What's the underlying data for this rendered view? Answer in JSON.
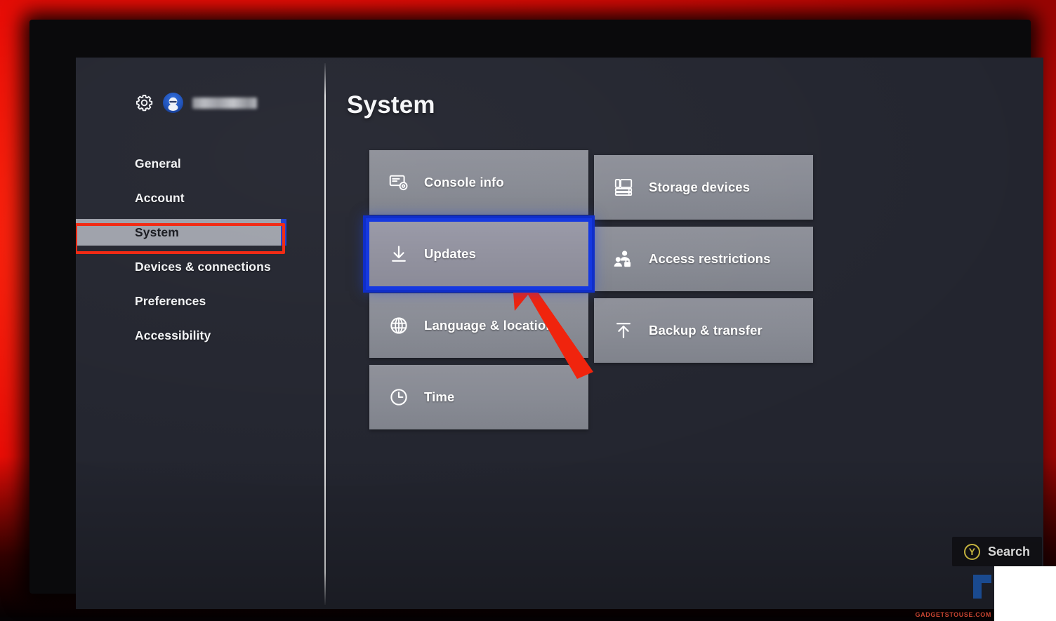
{
  "device": {
    "frame_color": "#e80d06",
    "screen_bg": "#23252f"
  },
  "sidebar": {
    "gear_icon": "gear-icon",
    "avatar_icon": "avatar-icon",
    "gamertag": "",
    "items": [
      {
        "label": "General",
        "selected": false
      },
      {
        "label": "Account",
        "selected": false
      },
      {
        "label": "System",
        "selected": true
      },
      {
        "label": "Devices & connections",
        "selected": false
      },
      {
        "label": "Preferences",
        "selected": false
      },
      {
        "label": "Accessibility",
        "selected": false
      }
    ]
  },
  "main": {
    "title": "System",
    "tiles_left": [
      {
        "label": "Console info",
        "icon": "console-info-icon",
        "focused": false
      },
      {
        "label": "Updates",
        "icon": "download-icon",
        "focused": true
      },
      {
        "label": "Language & location",
        "icon": "globe-icon",
        "focused": false
      },
      {
        "label": "Time",
        "icon": "clock-icon",
        "focused": false
      }
    ],
    "tiles_right": [
      {
        "label": "Storage devices",
        "icon": "storage-icon",
        "focused": false
      },
      {
        "label": "Access restrictions",
        "icon": "people-lock-icon",
        "focused": false
      },
      {
        "label": "Backup & transfer",
        "icon": "upload-icon",
        "focused": false
      }
    ]
  },
  "footer": {
    "search_button_label": "Search",
    "search_button_glyph": "Y"
  },
  "annotations": {
    "highlight_color": "#f1260f",
    "focus_color": "#1538e0",
    "arrow": "red-arrow-pointing-to-updates"
  },
  "overlay": {
    "watermark_text": "GADGETSTOUSE.COM"
  }
}
